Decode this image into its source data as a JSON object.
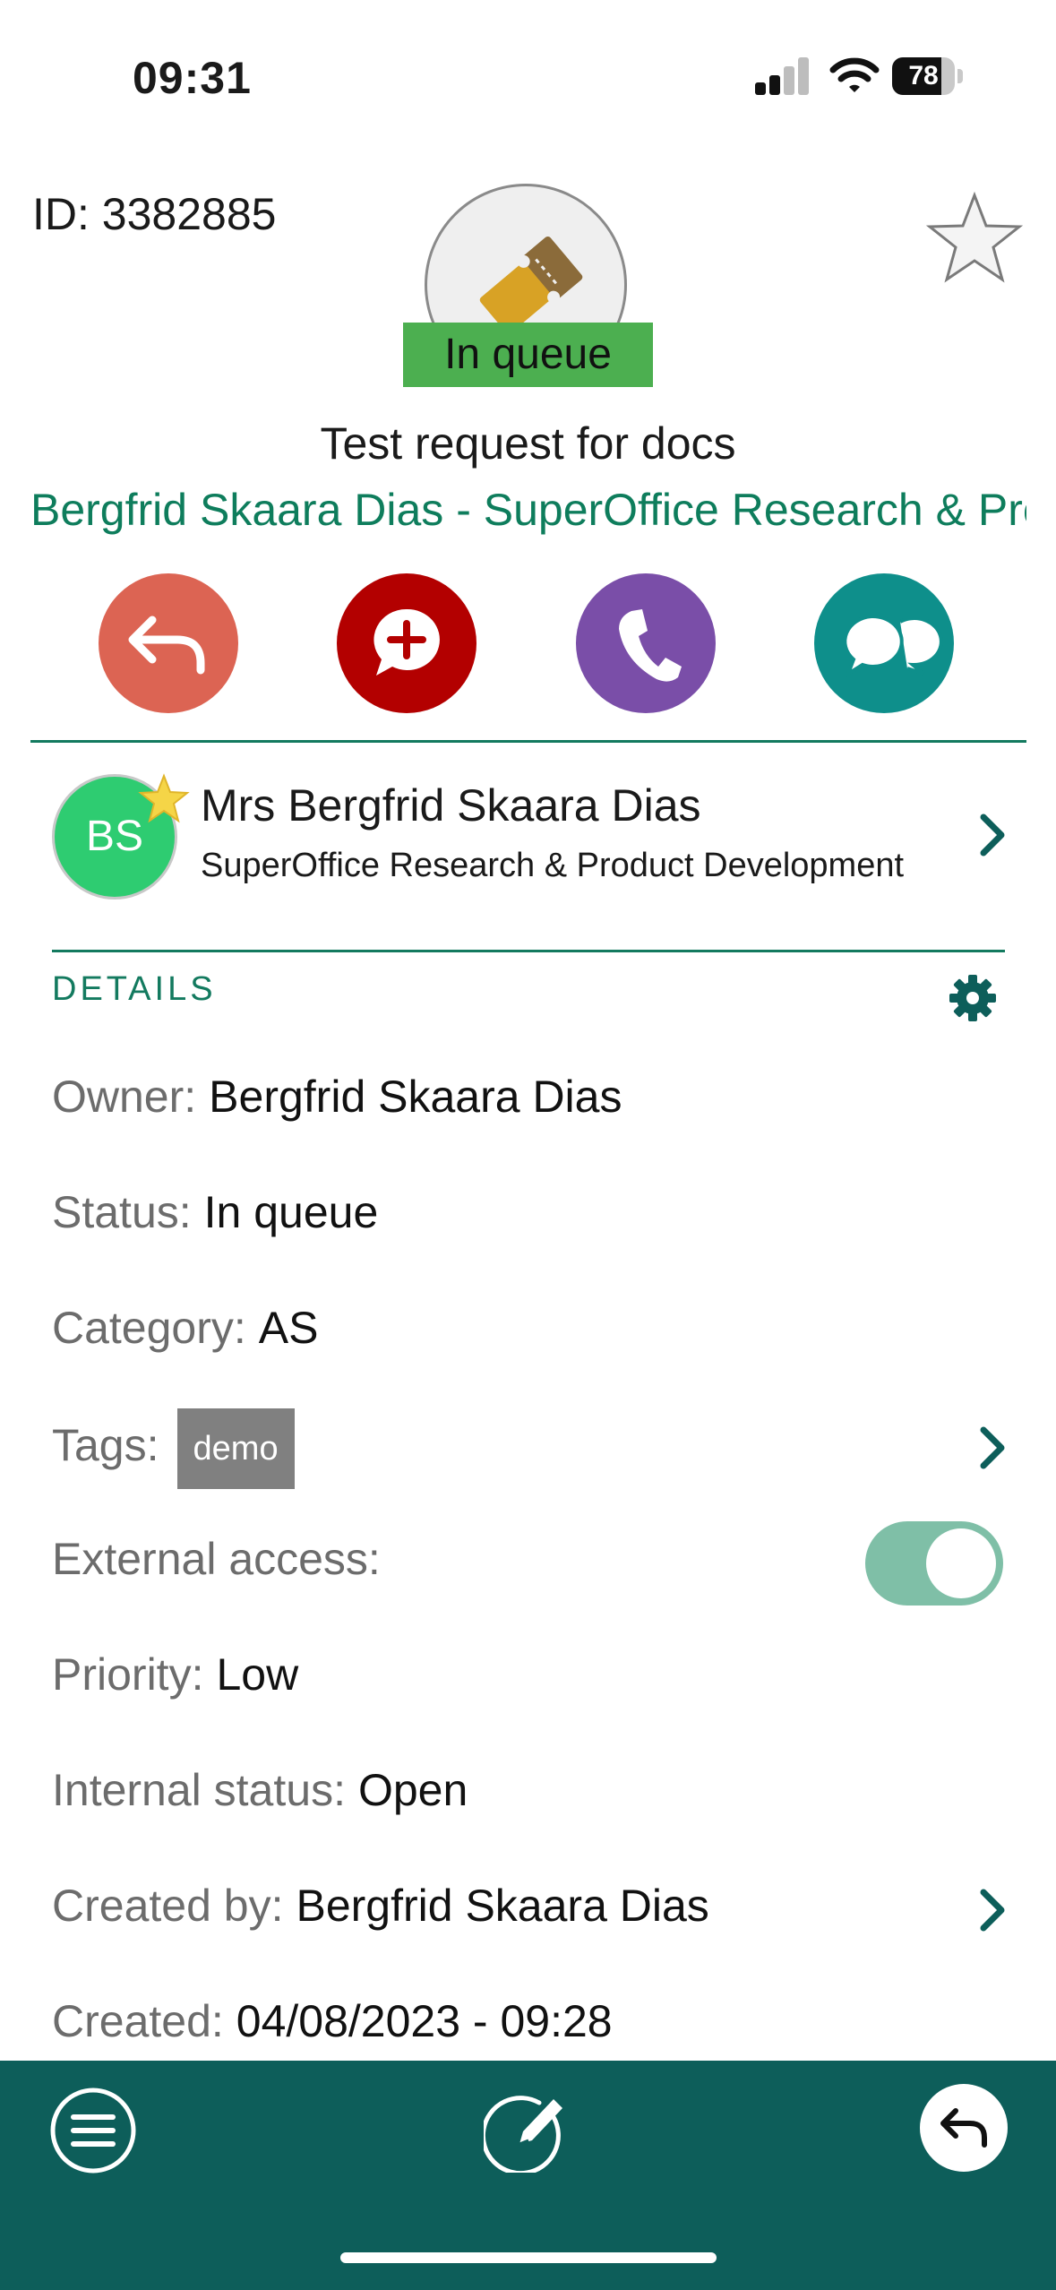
{
  "status_bar": {
    "time": "09:31",
    "battery_percent": "78",
    "battery_level": 0.78,
    "signal_bars_active": 2,
    "icons": [
      "signal-icon",
      "wifi-icon",
      "battery-icon"
    ]
  },
  "header": {
    "ticket_id": "ID: 3382885",
    "status_badge": "In queue",
    "title": "Test request for docs",
    "subtitle": "Bergfrid Skaara Dias - SuperOffice Research & Product Development",
    "favorite_icon": "star-outline-icon",
    "ticket_icon": "ticket-icon"
  },
  "actions": [
    {
      "name": "reply",
      "icon": "reply-icon",
      "color": "#dc6453"
    },
    {
      "name": "add-message",
      "icon": "add-message-icon",
      "color": "#b30000"
    },
    {
      "name": "call",
      "icon": "phone-icon",
      "color": "#7a4ea8"
    },
    {
      "name": "chat",
      "icon": "chat-icon",
      "color": "#0e8f8b"
    }
  ],
  "contact": {
    "initials": "BS",
    "name": "Mrs Bergfrid Skaara Dias",
    "company": "SuperOffice Research & Product Development",
    "avatar_color": "#2ecc71",
    "badge_icon": "star-icon"
  },
  "details": {
    "section_label": "DETAILS",
    "owner_label": "Owner:",
    "owner_value": "Bergfrid Skaara Dias",
    "status_label": "Status:",
    "status_value": "In queue",
    "category_label": "Category:",
    "category_value": "AS",
    "tags_label": "Tags:",
    "tags": [
      "demo"
    ],
    "external_access_label": "External access:",
    "external_access_on": true,
    "priority_label": "Priority:",
    "priority_value": "Low",
    "internal_status_label": "Internal status:",
    "internal_status_value": "Open",
    "created_by_label": "Created by:",
    "created_by_value": "Bergfrid Skaara Dias",
    "created_label": "Created:",
    "created_value": "04/08/2023 - 09:28"
  },
  "bottom_bar": {
    "menu_icon": "menu-icon",
    "edit_icon": "edit-icon",
    "reply_icon": "reply-icon",
    "color": "#0d5e5a"
  },
  "colors": {
    "accent_green": "#137a5f",
    "status_green": "#4caf50"
  }
}
